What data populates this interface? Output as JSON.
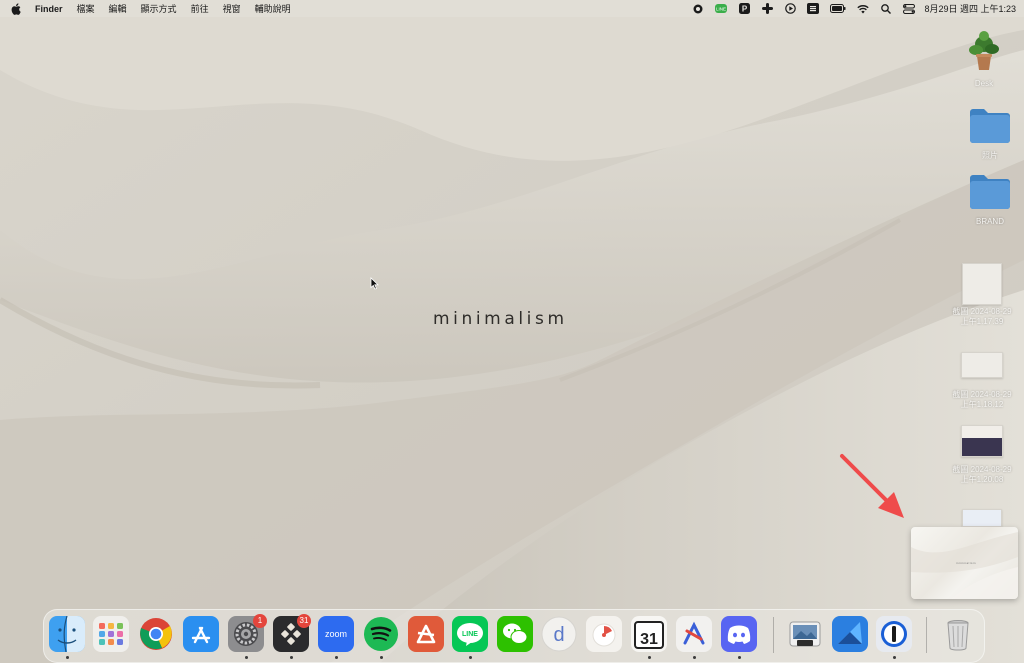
{
  "menubar": {
    "app_name": "Finder",
    "menus": [
      "檔案",
      "編輯",
      "顯示方式",
      "前往",
      "視窗",
      "輔助說明"
    ],
    "status_icons": [
      "screen-record-icon",
      "line-status-icon",
      "p-app-icon",
      "slack-icon",
      "play-circle-icon",
      "menu-app-icon",
      "battery-icon",
      "wifi-icon",
      "spotlight-search-icon",
      "control-center-icon"
    ],
    "clock": "8月29日 週四 上午1:23"
  },
  "wallpaper": {
    "text": "minimalism"
  },
  "desktop_icons": [
    {
      "name": "Desk",
      "kind": "plant-image"
    },
    {
      "name": "照片",
      "kind": "folder"
    },
    {
      "name": "BRAND",
      "kind": "folder"
    },
    {
      "name": "截圖 2024-08-29",
      "sub": "上午1.17.39",
      "kind": "screenshot"
    },
    {
      "name": "截圖 2024-08-29",
      "sub": "上午1.18.12",
      "kind": "screenshot"
    },
    {
      "name": "截圖 2024-08-29",
      "sub": "上午1.20.08",
      "kind": "screenshot"
    }
  ],
  "preview": {
    "text": "minimalism"
  },
  "dock": {
    "apps": [
      "Finder",
      "Launchpad",
      "Google Chrome",
      "App Store",
      "系統設定",
      "Tes",
      "Zoom",
      "Spotify",
      "Affinity",
      "LINE",
      "WeChat",
      "Dayone",
      "Fantastical",
      "31",
      "Craft",
      "Discord",
      "Preview",
      "CleanShot",
      "1Password",
      "垃圾桶"
    ],
    "zoom_label": "zoom",
    "line_label": "LINE",
    "calendar_label": "31",
    "dayone_label": "d",
    "badges": {
      "settings": "1",
      "tes": "31"
    }
  },
  "colors": {
    "accent_red": "#e4453c",
    "folder_blue": "#4a8fd0",
    "arrow_red": "#ef4b4b"
  }
}
